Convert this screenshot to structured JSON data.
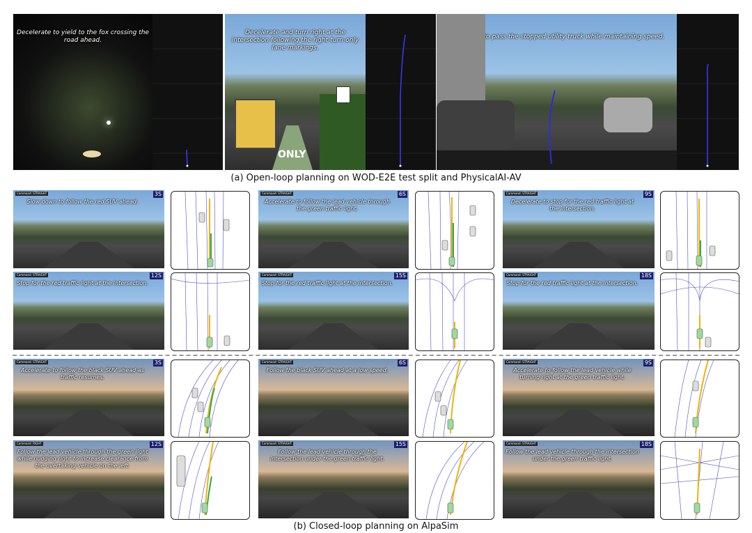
{
  "labels": {
    "a": "(a) Open-loop planning on WOD-E2E test split and PhysicalAI-AV",
    "b": "(b) Closed-loop planning on AlpaSim"
  },
  "open_loop": [
    {
      "caption": "Decelerate to yield to the fox crossing the road ahead.",
      "style": "night"
    },
    {
      "caption": "Decelerate and turn right at the intersection following the right-turn-only lane markings.",
      "style": "day",
      "sign": "ONLY"
    },
    {
      "caption": "Nudge left to pass the stopped utility truck while maintaining speed.",
      "style": "day"
    }
  ],
  "closed_loop_top": [
    {
      "time": "3S",
      "command": "Command: STRAIGHT",
      "caption": "Slow down to follow the red SUV ahead."
    },
    {
      "time": "6S",
      "command": "Command: STRAIGHT",
      "caption": "Accelerate to follow the lead vehicle through the green traffic light."
    },
    {
      "time": "9S",
      "command": "Command: STRAIGHT",
      "caption": "Decelerate to stop for the red traffic light at the intersection."
    },
    {
      "time": "12S",
      "command": "Command: STRAIGHT",
      "caption": "Stop for the red traffic light at the intersection."
    },
    {
      "time": "15S",
      "command": "Command: STRAIGHT",
      "caption": "Stop for the red traffic light at the intersection."
    },
    {
      "time": "18S",
      "command": "Command: STRAIGHT",
      "caption": "Stop for the red traffic light at the intersection."
    }
  ],
  "closed_loop_bottom": [
    {
      "time": "3S",
      "command": "Command: STRAIGHT",
      "caption": "Accelerate to follow the black SUV ahead as traffic resumes."
    },
    {
      "time": "6S",
      "command": "Command: STRAIGHT",
      "caption": "Follow the black SUV ahead at a low speed."
    },
    {
      "time": "9S",
      "command": "Command: STRAIGHT",
      "caption": "Accelerate to follow the lead vehicle while turning right at the green traffic light."
    },
    {
      "time": "12S",
      "command": "Command: RIGHT",
      "caption": "Follow the lead vehicle through the green light while nudging right to increase clearance from the overtaking vehicle on the left."
    },
    {
      "time": "15S",
      "command": "Command: STRAIGHT",
      "caption": "Follow the lead vehicle through the intersection under the green traffic light."
    },
    {
      "time": "18S",
      "command": "Command: STRAIGHT",
      "caption": "Follow the lead vehicle through the intersection under the green traffic light."
    }
  ],
  "colors": {
    "trajectory_pred": "#f0b400",
    "trajectory_gt": "#2fa84f",
    "lanes": "#4b4bcc",
    "time_badge": "#1b1f6b"
  }
}
